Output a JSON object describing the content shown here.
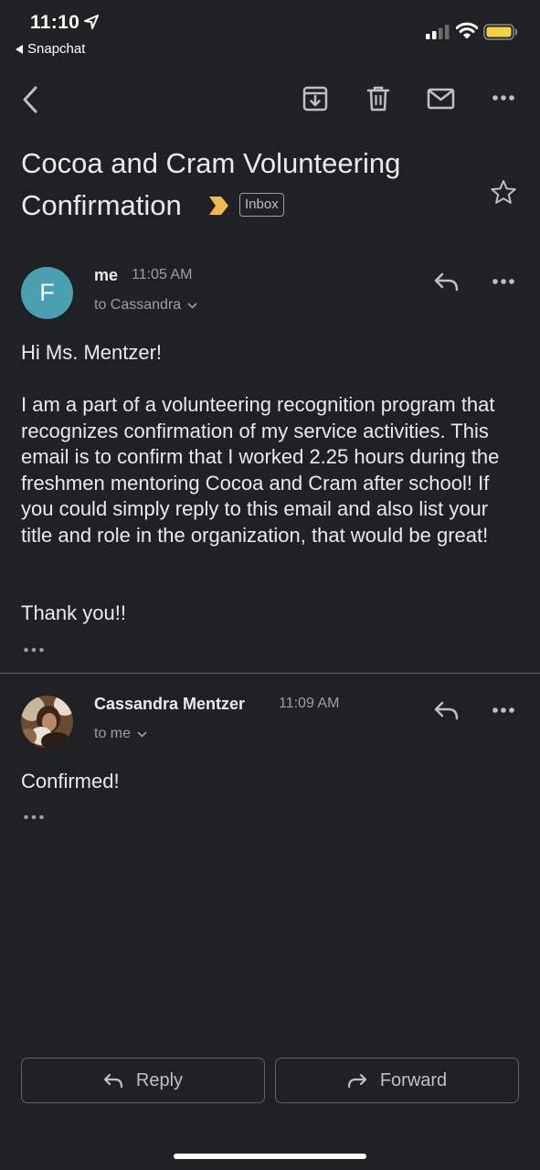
{
  "status_bar": {
    "time": "11:10",
    "back_app": "Snapchat"
  },
  "toolbar": {
    "icons": [
      "back-arrow-icon",
      "archive-icon",
      "trash-icon",
      "mark-unread-icon",
      "more-icon"
    ]
  },
  "subject": {
    "title": "Cocoa and Cram Volunteering Confirmation",
    "label": "Inbox"
  },
  "messages": [
    {
      "avatar_initial": "F",
      "sender": "me",
      "time": "11:05 AM",
      "recipient": "to Cassandra",
      "greeting": "Hi Ms. Mentzer!",
      "body": "I am a part of a volunteering recognition program that recognizes confirmation of my service activities. This email is to confirm that I worked 2.25 hours during the freshmen mentoring Cocoa and Cram after school! If you could simply reply to this email and also list your title and role in the organization, that would be great!",
      "closing": "Thank you!!"
    },
    {
      "sender": "Cassandra Mentzer",
      "time": "11:09 AM",
      "recipient": "to me",
      "body": "Confirmed!"
    }
  ],
  "actions": {
    "reply": "Reply",
    "forward": "Forward"
  },
  "colors": {
    "background": "#202124",
    "avatar_f": "#4a9fb0",
    "importance": "#f2b84b"
  }
}
